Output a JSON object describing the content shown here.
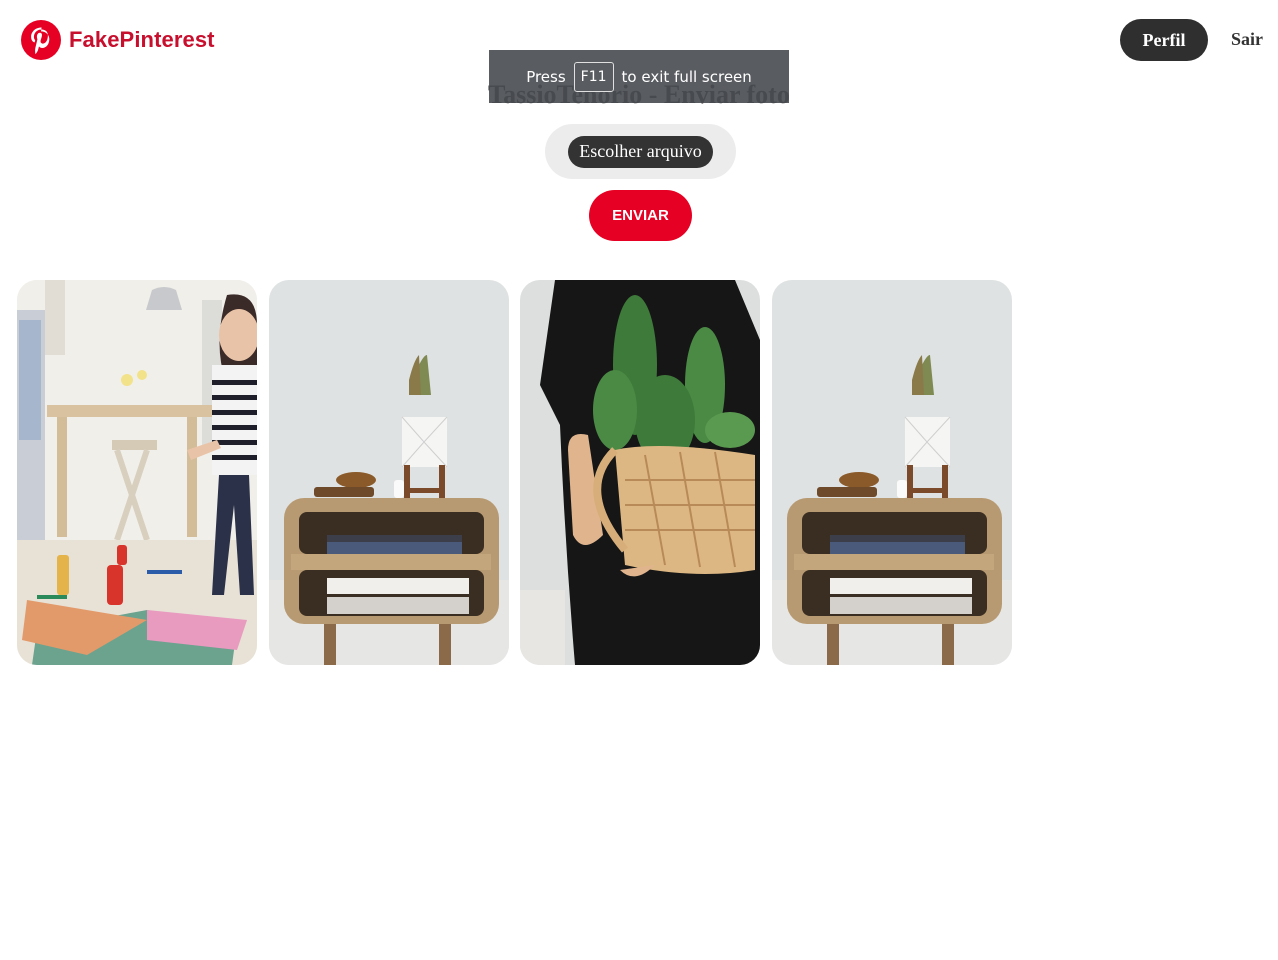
{
  "header": {
    "brand": "FakePinterest",
    "profile_label": "Perfil",
    "logout_label": "Sair"
  },
  "page": {
    "title": "TassioTenorio - Enviar foto"
  },
  "form": {
    "file_button_label": "Escolher arquivo",
    "submit_label": "ENVIAR"
  },
  "toast": {
    "prefix": "Press",
    "key": "F11",
    "suffix": "to exit full screen"
  },
  "photos": [
    {
      "subject": "child-drawing-on-floor"
    },
    {
      "subject": "wooden-nightstand-with-books"
    },
    {
      "subject": "person-holding-cactus-basket"
    },
    {
      "subject": "wooden-nightstand-with-books"
    }
  ],
  "colors": {
    "brand_red": "#c8102e",
    "submit_red": "#e60023",
    "dark_button": "#2f2f2f"
  },
  "icons": {
    "logo": "pinterest-logo-icon"
  }
}
